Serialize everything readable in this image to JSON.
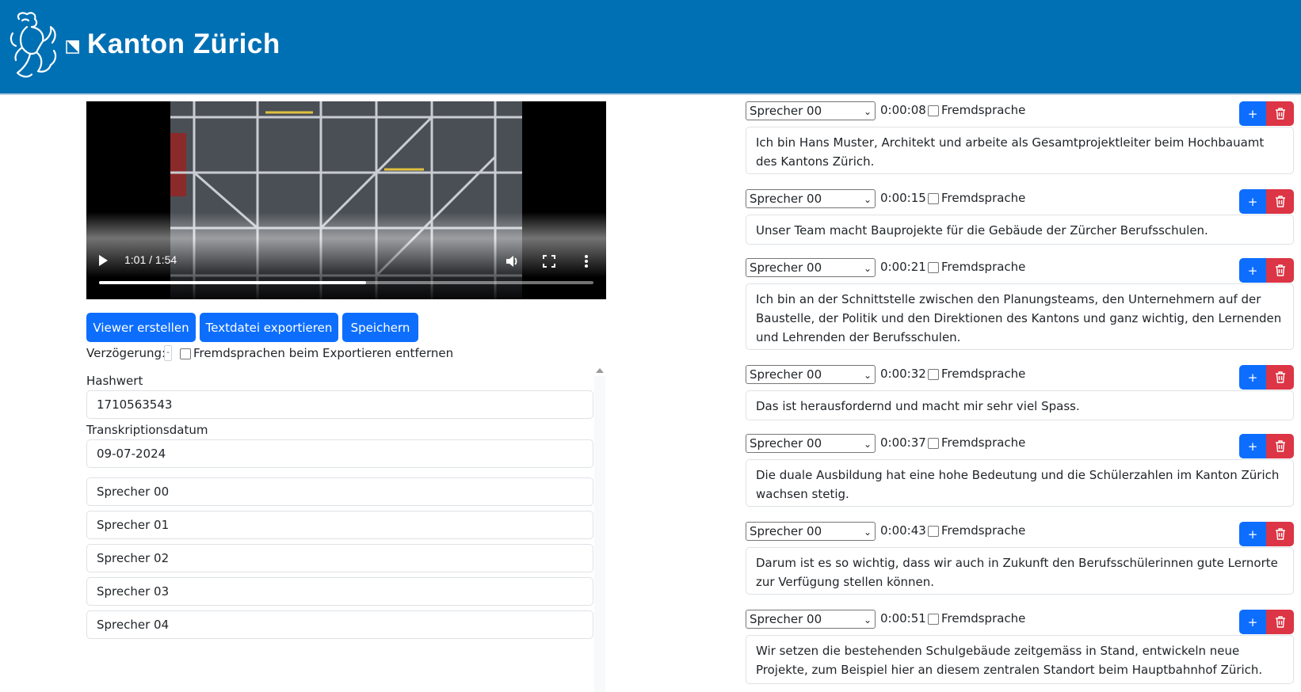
{
  "header": {
    "brand": "Kanton Zürich"
  },
  "video": {
    "time": "1:01 / 1:54",
    "progress": 0.54
  },
  "toolbar": {
    "viewer_label": "Viewer erstellen",
    "export_label": "Textdatei exportieren",
    "save_label": "Speichern"
  },
  "options": {
    "delay_label": "Verzögerung:",
    "delay_value": "-",
    "remove_foreign_label": "Fremdsprachen beim Exportieren entfernen"
  },
  "meta": {
    "hash_label": "Hashwert",
    "hash_value": "1710563543",
    "date_label": "Transkriptionsdatum",
    "date_value": "09-07-2024"
  },
  "speakers": [
    "Sprecher 00",
    "Sprecher 01",
    "Sprecher 02",
    "Sprecher 03",
    "Sprecher 04"
  ],
  "segments": [
    {
      "speaker": "Sprecher 00",
      "time": "0:00:08",
      "foreign_label": "Fremdsprache",
      "add_label": "+",
      "text": "Ich bin Hans Muster, Architekt und arbeite als Gesamtprojektleiter beim Hochbauamt des Kantons Zürich."
    },
    {
      "speaker": "Sprecher 00",
      "time": "0:00:15",
      "foreign_label": "Fremdsprache",
      "add_label": "+",
      "text": "Unser Team macht Bauprojekte für die Gebäude der Zürcher Berufsschulen."
    },
    {
      "speaker": "Sprecher 00",
      "time": "0:00:21",
      "foreign_label": "Fremdsprache",
      "add_label": "+",
      "text": "Ich bin an der Schnittstelle zwischen den Planungsteams, den Unternehmern auf der Baustelle, der Politik und den Direktionen des Kantons und ganz wichtig, den Lernenden und Lehrenden der Berufsschulen."
    },
    {
      "speaker": "Sprecher 00",
      "time": "0:00:32",
      "foreign_label": "Fremdsprache",
      "add_label": "+",
      "text": "Das ist herausfordernd und macht mir sehr viel Spass."
    },
    {
      "speaker": "Sprecher 00",
      "time": "0:00:37",
      "foreign_label": "Fremdsprache",
      "add_label": "+",
      "text": "Die duale Ausbildung hat eine hohe Bedeutung und die Schülerzahlen im Kanton Zürich wachsen stetig."
    },
    {
      "speaker": "Sprecher 00",
      "time": "0:00:43",
      "foreign_label": "Fremdsprache",
      "add_label": "+",
      "text": "Darum ist es so wichtig, dass wir auch in Zukunft den Berufsschülerinnen gute Lernorte zur Verfügung stellen können."
    },
    {
      "speaker": "Sprecher 00",
      "time": "0:00:51",
      "foreign_label": "Fremdsprache",
      "add_label": "+",
      "text": "Wir setzen die bestehenden Schulgebäude zeitgemäss in Stand, entwickeln neue Projekte, zum Beispiel hier an diesem zentralen Standort beim Hauptbahnhof Zürich."
    }
  ],
  "colors": {
    "brand": "#0070b4",
    "primary": "#0d6efd",
    "danger": "#dc3545"
  }
}
